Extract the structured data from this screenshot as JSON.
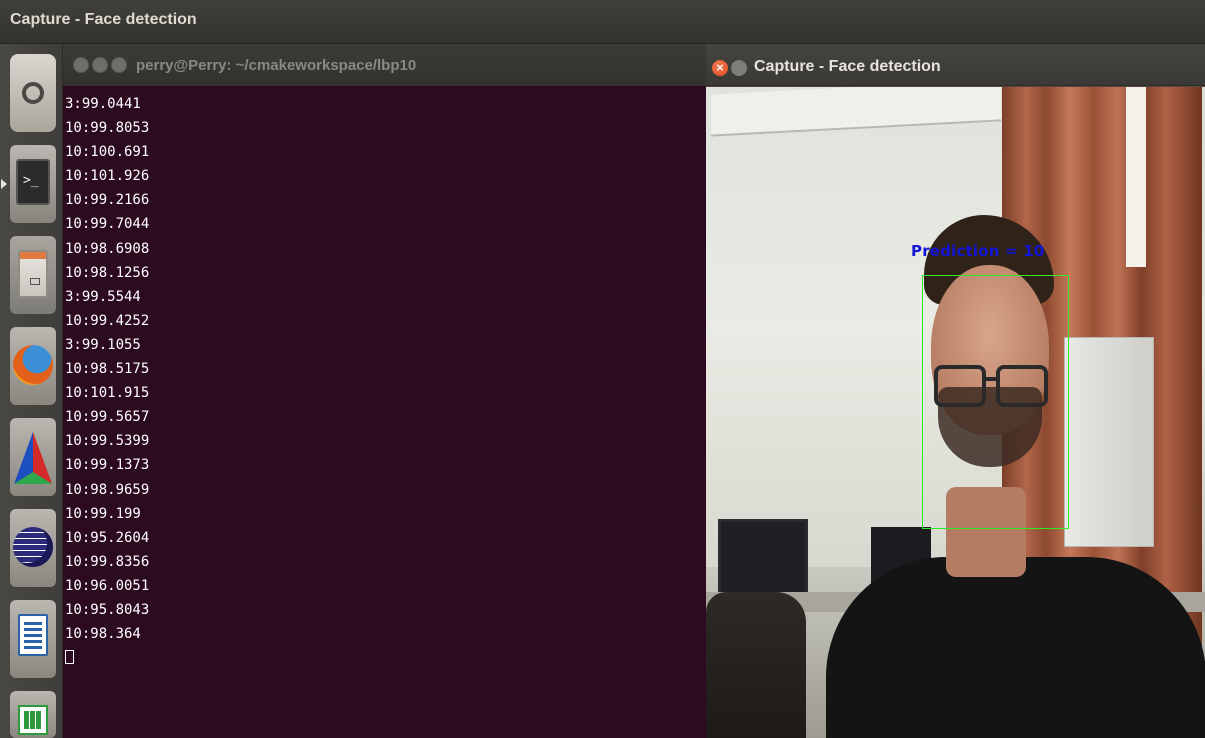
{
  "top_panel": {
    "title": "Capture - Face detection"
  },
  "launcher": {
    "items": [
      {
        "name": "ubuntu-dash",
        "icon": "ubuntu-logo-icon"
      },
      {
        "name": "terminal",
        "icon": "terminal-icon",
        "active": true
      },
      {
        "name": "files",
        "icon": "file-cabinet-icon"
      },
      {
        "name": "firefox",
        "icon": "firefox-icon"
      },
      {
        "name": "cmake",
        "icon": "cmake-triangle-icon"
      },
      {
        "name": "eclipse",
        "icon": "eclipse-icon"
      },
      {
        "name": "libreoffice-writer",
        "icon": "writer-document-icon"
      },
      {
        "name": "libreoffice-calc",
        "icon": "calc-spreadsheet-icon"
      }
    ]
  },
  "terminal": {
    "title": "perry@Perry: ~/cmakeworkspace/lbp10",
    "background": "#2c0a1f",
    "lines": [
      "3:99.0441",
      "10:99.8053",
      "10:100.691",
      "10:101.926",
      "10:99.2166",
      "10:99.7044",
      "10:98.6908",
      "10:98.1256",
      "3:99.5544",
      "10:99.4252",
      "3:99.1055",
      "10:98.5175",
      "10:101.915",
      "10:99.5657",
      "10:99.5399",
      "10:99.1373",
      "10:98.9659",
      "10:99.199",
      "10:95.2604",
      "10:99.8356",
      "10:96.0051",
      "10:95.8043",
      "10:98.364"
    ]
  },
  "capture_window": {
    "title": "Capture - Face detection",
    "close_glyph": "×",
    "prediction_label": "Prediction = 10",
    "box_color": "#2ee82a",
    "label_color": "#1414d8"
  }
}
